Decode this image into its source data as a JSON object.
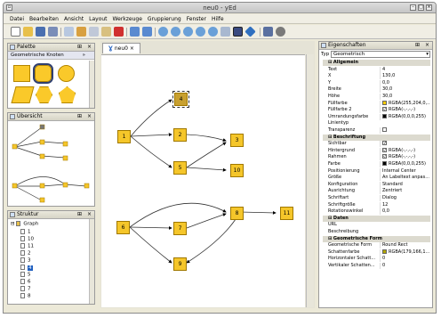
{
  "window": {
    "title": "neu0 - yEd"
  },
  "menu": [
    "Datei",
    "Bearbeiten",
    "Ansicht",
    "Layout",
    "Werkzeuge",
    "Gruppierung",
    "Fenster",
    "Hilfe"
  ],
  "palette": {
    "title": "Palette",
    "section": "Geometrische Knoten"
  },
  "overview": {
    "title": "Übersicht"
  },
  "structure": {
    "title": "Struktur",
    "root": "Graph",
    "items": [
      "1",
      "10",
      "11",
      "2",
      "3",
      "4",
      "5",
      "6",
      "7",
      "8",
      "9"
    ],
    "selected": "4"
  },
  "editor": {
    "tab": "neu0"
  },
  "graph": {
    "nodes": [
      "1",
      "2",
      "3",
      "4",
      "5",
      "6",
      "7",
      "8",
      "9",
      "10",
      "11"
    ],
    "selected": "4"
  },
  "properties": {
    "title": "Eigenschaften",
    "type_label": "Typ",
    "type_value": "Geometrisch",
    "sections": [
      {
        "name": "Allgemein",
        "rows": [
          {
            "k": "Text",
            "v": "4"
          },
          {
            "k": "X",
            "v": "130,0"
          },
          {
            "k": "Y",
            "v": "0,0"
          },
          {
            "k": "Breite",
            "v": "30,0"
          },
          {
            "k": "Höhe",
            "v": "30,0"
          },
          {
            "k": "Füllfarbe",
            "v": "RGBA(255,204,0,...",
            "swatch": "#ffcc00"
          },
          {
            "k": "Füllfarbe 2",
            "v": "RGBA(-,-,-,-)",
            "swatch": "none"
          },
          {
            "k": "Umrandungsfarbe",
            "v": "RGBA(0,0,0,255)",
            "swatch": "#000000"
          },
          {
            "k": "Linientyp",
            "v": ""
          },
          {
            "k": "Transparenz",
            "v": "",
            "checkbox": false
          }
        ]
      },
      {
        "name": "Beschriftung",
        "rows": [
          {
            "k": "Sichtbar",
            "v": "",
            "checkbox": true
          },
          {
            "k": "Hintergrund",
            "v": "RGBA(-,-,-,-)",
            "swatch": "none"
          },
          {
            "k": "Rahmen",
            "v": "RGBA(-,-,-,-)",
            "swatch": "none"
          },
          {
            "k": "Farbe",
            "v": "RGBA(0,0,0,255)",
            "swatch": "#000000"
          },
          {
            "k": "Positionierung",
            "v": "Internal Center"
          },
          {
            "k": "Größe",
            "v": "An Labeltext anpas..."
          },
          {
            "k": "Konfiguration",
            "v": "Standard"
          },
          {
            "k": "Ausrichtung",
            "v": "Zentriert"
          },
          {
            "k": "Schriftart",
            "v": "Dialog"
          },
          {
            "k": "Schriftgröße",
            "v": "12"
          },
          {
            "k": "Rotationswinkel",
            "v": "0,0"
          }
        ]
      },
      {
        "name": "Daten",
        "rows": [
          {
            "k": "URL",
            "v": ""
          },
          {
            "k": "Beschreibung",
            "v": ""
          }
        ]
      },
      {
        "name": "Geometrische Form",
        "rows": [
          {
            "k": "Geometrische Form",
            "v": "Round Rect"
          },
          {
            "k": "Schattenfarbe",
            "v": "RGBA(179,166,1...",
            "swatch": "#b3a601"
          },
          {
            "k": "Horizontaler Schatt...",
            "v": "0"
          },
          {
            "k": "Vertikaler Schatten...",
            "v": "0"
          }
        ]
      }
    ]
  },
  "colors": {
    "node": "#f5c62a",
    "accent": "#2060c0"
  }
}
